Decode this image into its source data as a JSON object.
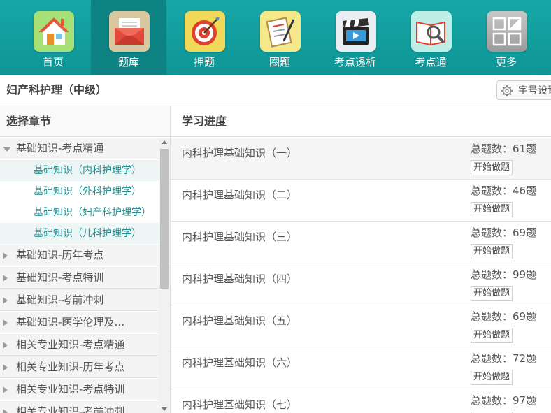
{
  "nav": {
    "items": [
      {
        "label": "首页",
        "icon": "home-icon"
      },
      {
        "label": "题库",
        "icon": "envelope-icon"
      },
      {
        "label": "押题",
        "icon": "target-icon"
      },
      {
        "label": "圈题",
        "icon": "clipboard-icon"
      },
      {
        "label": "考点透析",
        "icon": "clapperboard-icon"
      },
      {
        "label": "考点通",
        "icon": "magnifier-book-icon"
      },
      {
        "label": "更多",
        "icon": "grid-icon"
      }
    ],
    "active_index": 1
  },
  "header": {
    "title": "妇产科护理（中级）",
    "font_button_label": "字号设置"
  },
  "sidebar": {
    "heading": "选择章节",
    "groups": [
      {
        "label": "基础知识-考点精通",
        "expanded": true,
        "children": [
          "基础知识（内科护理学）",
          "基础知识（外科护理学）",
          "基础知识（妇产科护理学）",
          "基础知识（儿科护理学）"
        ]
      },
      {
        "label": "基础知识-历年考点",
        "expanded": false
      },
      {
        "label": "基础知识-考点特训",
        "expanded": false
      },
      {
        "label": "基础知识-考前冲刺",
        "expanded": false
      },
      {
        "label": "基础知识-医学伦理及…",
        "expanded": false
      },
      {
        "label": "相关专业知识-考点精通",
        "expanded": false
      },
      {
        "label": "相关专业知识-历年考点",
        "expanded": false
      },
      {
        "label": "相关专业知识-考点特训",
        "expanded": false
      },
      {
        "label": "相关专业知识-考前冲刺",
        "expanded": false
      }
    ]
  },
  "progress": {
    "heading": "学习进度",
    "start_label": "开始做题",
    "rows": [
      {
        "name": "内科护理基础知识（一）",
        "total": "总题数：61题"
      },
      {
        "name": "内科护理基础知识（二）",
        "total": "总题数：46题"
      },
      {
        "name": "内科护理基础知识（三）",
        "total": "总题数：69题"
      },
      {
        "name": "内科护理基础知识（四）",
        "total": "总题数：99题"
      },
      {
        "name": "内科护理基础知识（五）",
        "total": "总题数：69题"
      },
      {
        "name": "内科护理基础知识（六）",
        "total": "总题数：72题"
      },
      {
        "name": "内科护理基础知识（七）",
        "total": "总题数：97题"
      }
    ]
  },
  "colors": {
    "nav_bg": "#17a7a7",
    "nav_active": "#0d8383",
    "sub_item_text": "#1f8f8f"
  }
}
